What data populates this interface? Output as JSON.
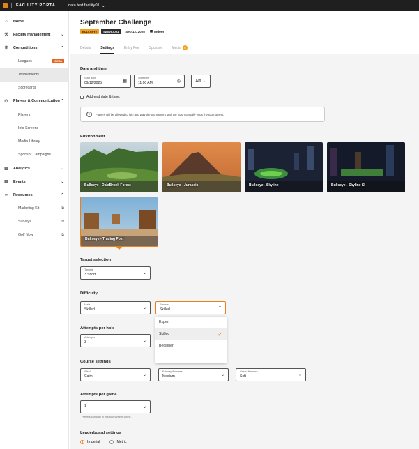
{
  "topbar": {
    "brand": "FACILITY PORTAL",
    "facility": "data test facility01",
    "facility_chevron": "chevron-down-icon"
  },
  "sidebar": {
    "home": "Home",
    "facility_management": "Facility management",
    "competitions": "Competitions",
    "leagues": "Leagues",
    "leagues_badge": "BETA",
    "tournaments": "Tournaments",
    "scorecards": "Scorecards",
    "players_communication": "Players & Communication",
    "players": "Players",
    "info_screens": "Info Screens",
    "media_library": "Media Library",
    "sponsor_campaigns": "Sponsor Campaigns",
    "analytics": "Analytics",
    "events": "Events",
    "resources": "Resources",
    "marketing_kit": "Marketing Kit",
    "surveys": "Surveys",
    "golf_now": "Golf Now"
  },
  "header": {
    "title": "September Challenge",
    "tag_mode": "BULLSEYE",
    "tag_type": "INDIVIDUAL",
    "date": "Sep 12, 2025",
    "location": "Indoor"
  },
  "tabs": [
    {
      "label": "Details"
    },
    {
      "label": "Settings"
    },
    {
      "label": "Entry Fee"
    },
    {
      "label": "Sponsor"
    },
    {
      "label": "Media",
      "count": "6"
    }
  ],
  "date_time": {
    "heading": "Date and time",
    "start_date_label": "Start date",
    "start_date_value": "09/12/2025",
    "start_time_label": "Start time",
    "start_time_value": "11:00 AM",
    "clock_format": "12h",
    "add_end": "Add end date & time.",
    "info": "Players will be allowed to join and play the tournament until the host manually ends the tournament."
  },
  "environment": {
    "heading": "Environment",
    "items": [
      {
        "name": "Bullseye - DaleBrook Forest"
      },
      {
        "name": "Bullseye - Jurassic"
      },
      {
        "name": "Bullseye - Skyline"
      },
      {
        "name": "Bullseye - Skyline SI"
      },
      {
        "name": "Bullseye - Trading Post"
      }
    ]
  },
  "target": {
    "heading": "Target selection",
    "label": "Targets",
    "value": "3 Short"
  },
  "difficulty": {
    "heading": "Difficulty",
    "male_label": "Male",
    "male_value": "Skilled",
    "female_label": "Female",
    "female_value": "Skilled",
    "options": [
      "Expert",
      "Skilled",
      "Beginner"
    ]
  },
  "attempts_hole": {
    "heading": "Attempts per hole",
    "label": "Attempts",
    "value": "3"
  },
  "course": {
    "heading": "Course settings",
    "wind_label": "Wind",
    "wind_value": "Calm",
    "fairway_label": "Fairway firmness",
    "fairway_value": "Medium",
    "green_label": "Green firmness",
    "green_value": "Soft"
  },
  "attempts_game": {
    "heading": "Attempts per game",
    "value": "1",
    "helper": "Players can play in this tournament 1 time."
  },
  "leaderboard": {
    "heading": "Leaderboard settings",
    "imperial": "Imperial",
    "metric": "Metric"
  },
  "colors": {
    "accent": "#e8801c",
    "topbar": "#1f1f1f",
    "tag_orange": "#f0a126"
  }
}
